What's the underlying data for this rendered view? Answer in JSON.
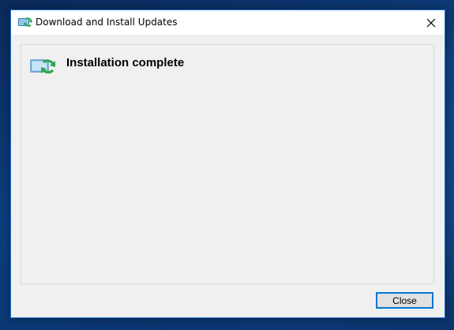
{
  "window": {
    "title": "Download and Install Updates",
    "app_icon": "windows-update-icon",
    "close_icon": "close-icon"
  },
  "content": {
    "status_icon": "update-complete-icon",
    "heading": "Installation complete"
  },
  "buttons": {
    "close_label": "Close"
  },
  "colors": {
    "accent": "#0078d7",
    "window_border": "#1f6fd1",
    "desktop": "#0d3f7e",
    "icon_green": "#2fa84f"
  }
}
